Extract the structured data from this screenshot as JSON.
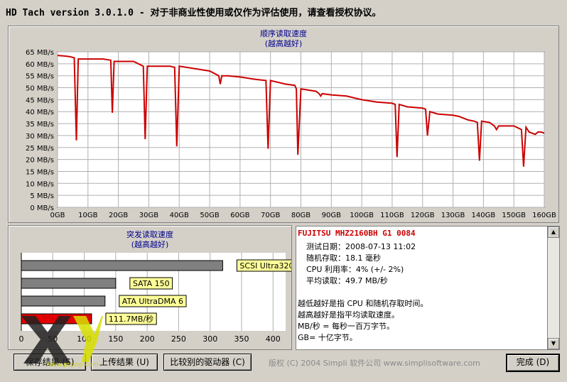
{
  "window": {
    "title": "HD Tach version 3.0.1.0  - 对于非商业性使用或仅作为评估使用，请查看授权协议。"
  },
  "chart_data": [
    {
      "type": "line",
      "title": "顺序读取速度",
      "subtitle": "(越高越好)",
      "xlabel": "",
      "ylabel": "",
      "xlim": [
        0,
        160
      ],
      "ylim": [
        0,
        65
      ],
      "grid": true,
      "x_tick_labels": [
        "0GB",
        "10GB",
        "20GB",
        "30GB",
        "40GB",
        "50GB",
        "60GB",
        "70GB",
        "80GB",
        "90GB",
        "100GB",
        "110GB",
        "120GB",
        "130GB",
        "140GB",
        "150GB",
        "160GB"
      ],
      "y_tick_labels": [
        "0 MB/s",
        "5 MB/s",
        "10 MB/s",
        "15 MB/s",
        "20 MB/s",
        "25 MB/s",
        "30 MB/s",
        "35 MB/s",
        "40 MB/s",
        "45 MB/s",
        "50 MB/s",
        "55 MB/s",
        "60 MB/s",
        "65 MB/s"
      ],
      "line_color": "#cc0000",
      "series": [
        {
          "x": [
            0,
            2,
            4,
            5.5,
            6.2,
            6.8,
            7.5,
            10,
            15,
            17.5,
            18,
            18.6,
            20,
            25,
            28.2,
            28.8,
            29.5,
            32,
            35,
            37,
            38.5,
            39.2,
            40,
            45,
            50,
            53,
            53.5,
            54,
            56,
            60,
            65,
            68.5,
            69.2,
            70,
            75,
            78,
            78.5,
            79,
            80,
            85,
            86,
            86.5,
            87,
            90,
            95,
            100,
            105,
            110,
            111,
            111.6,
            112.3,
            115,
            120,
            121,
            121.6,
            122.4,
            125,
            130,
            132,
            133,
            135,
            137,
            138,
            138.7,
            139.4,
            142,
            143.6,
            144.3,
            145,
            150,
            152.5,
            153.2,
            154,
            155,
            157,
            158,
            159,
            160
          ],
          "y": [
            63.5,
            63.3,
            63,
            62.5,
            28,
            62,
            62,
            62,
            62,
            61.5,
            39.5,
            61,
            61,
            61,
            59,
            28.5,
            59,
            59,
            59,
            59,
            58.5,
            25.5,
            59,
            58,
            57,
            55,
            51.5,
            55,
            55,
            54.5,
            53.5,
            53,
            24.5,
            53,
            51.5,
            51,
            49.5,
            22,
            49.5,
            48.5,
            47.5,
            46.5,
            47.5,
            47,
            46.5,
            45,
            44,
            43.5,
            43,
            21,
            43,
            42,
            41.5,
            41,
            30,
            40,
            39,
            38.5,
            38,
            37.5,
            36.5,
            36,
            35.5,
            19.5,
            36,
            35.5,
            34,
            32.5,
            34,
            34,
            32.5,
            17,
            33.5,
            31.5,
            30.5,
            31.5,
            31.5,
            31
          ]
        }
      ]
    },
    {
      "type": "bar",
      "title": "突发读取速度",
      "subtitle": "(越高越好)",
      "xlim": [
        0,
        420
      ],
      "x_tick_labels": [
        "0",
        "50",
        "100",
        "150",
        "200",
        "250",
        "300",
        "350",
        "400"
      ],
      "orientation": "horizontal",
      "categories": [
        "SCSI Ultra320",
        "SATA 150",
        "ATA UltraDMA 6",
        "111.7MB/秒"
      ],
      "values": [
        320,
        150,
        133,
        111.7
      ],
      "colors": [
        "#808080",
        "#808080",
        "#808080",
        "#e00000"
      ]
    }
  ],
  "info": {
    "drive_name": "FUJITSU MHZ2160BH G1 0084",
    "test_date": "测试日期：2008-07-13     11:02",
    "random_access": "随机存取：18.1 毫秒",
    "cpu": "CPU 利用率：4% (+/- 2%)",
    "avg_read": "平均读取：49.7 MB/秒",
    "note1": "越低越好是指 CPU 和随机存取时间。",
    "note2": "越高越好是指平均读取速度。",
    "note3": "MB/秒 = 每秒一百万字节。",
    "note4": "GB= 十亿字节。"
  },
  "buttons": {
    "save": "保存结果 (S)",
    "upload": "上传结果 (U)",
    "compare": "比较别的驱动器 (C)",
    "done": "完成 (D)"
  },
  "footer": {
    "copyright": "版权 (C) 2004 Simpli 软件公司 www.simplisoftware.com"
  },
  "watermark": {
    "text": "www.pcpop.com"
  }
}
